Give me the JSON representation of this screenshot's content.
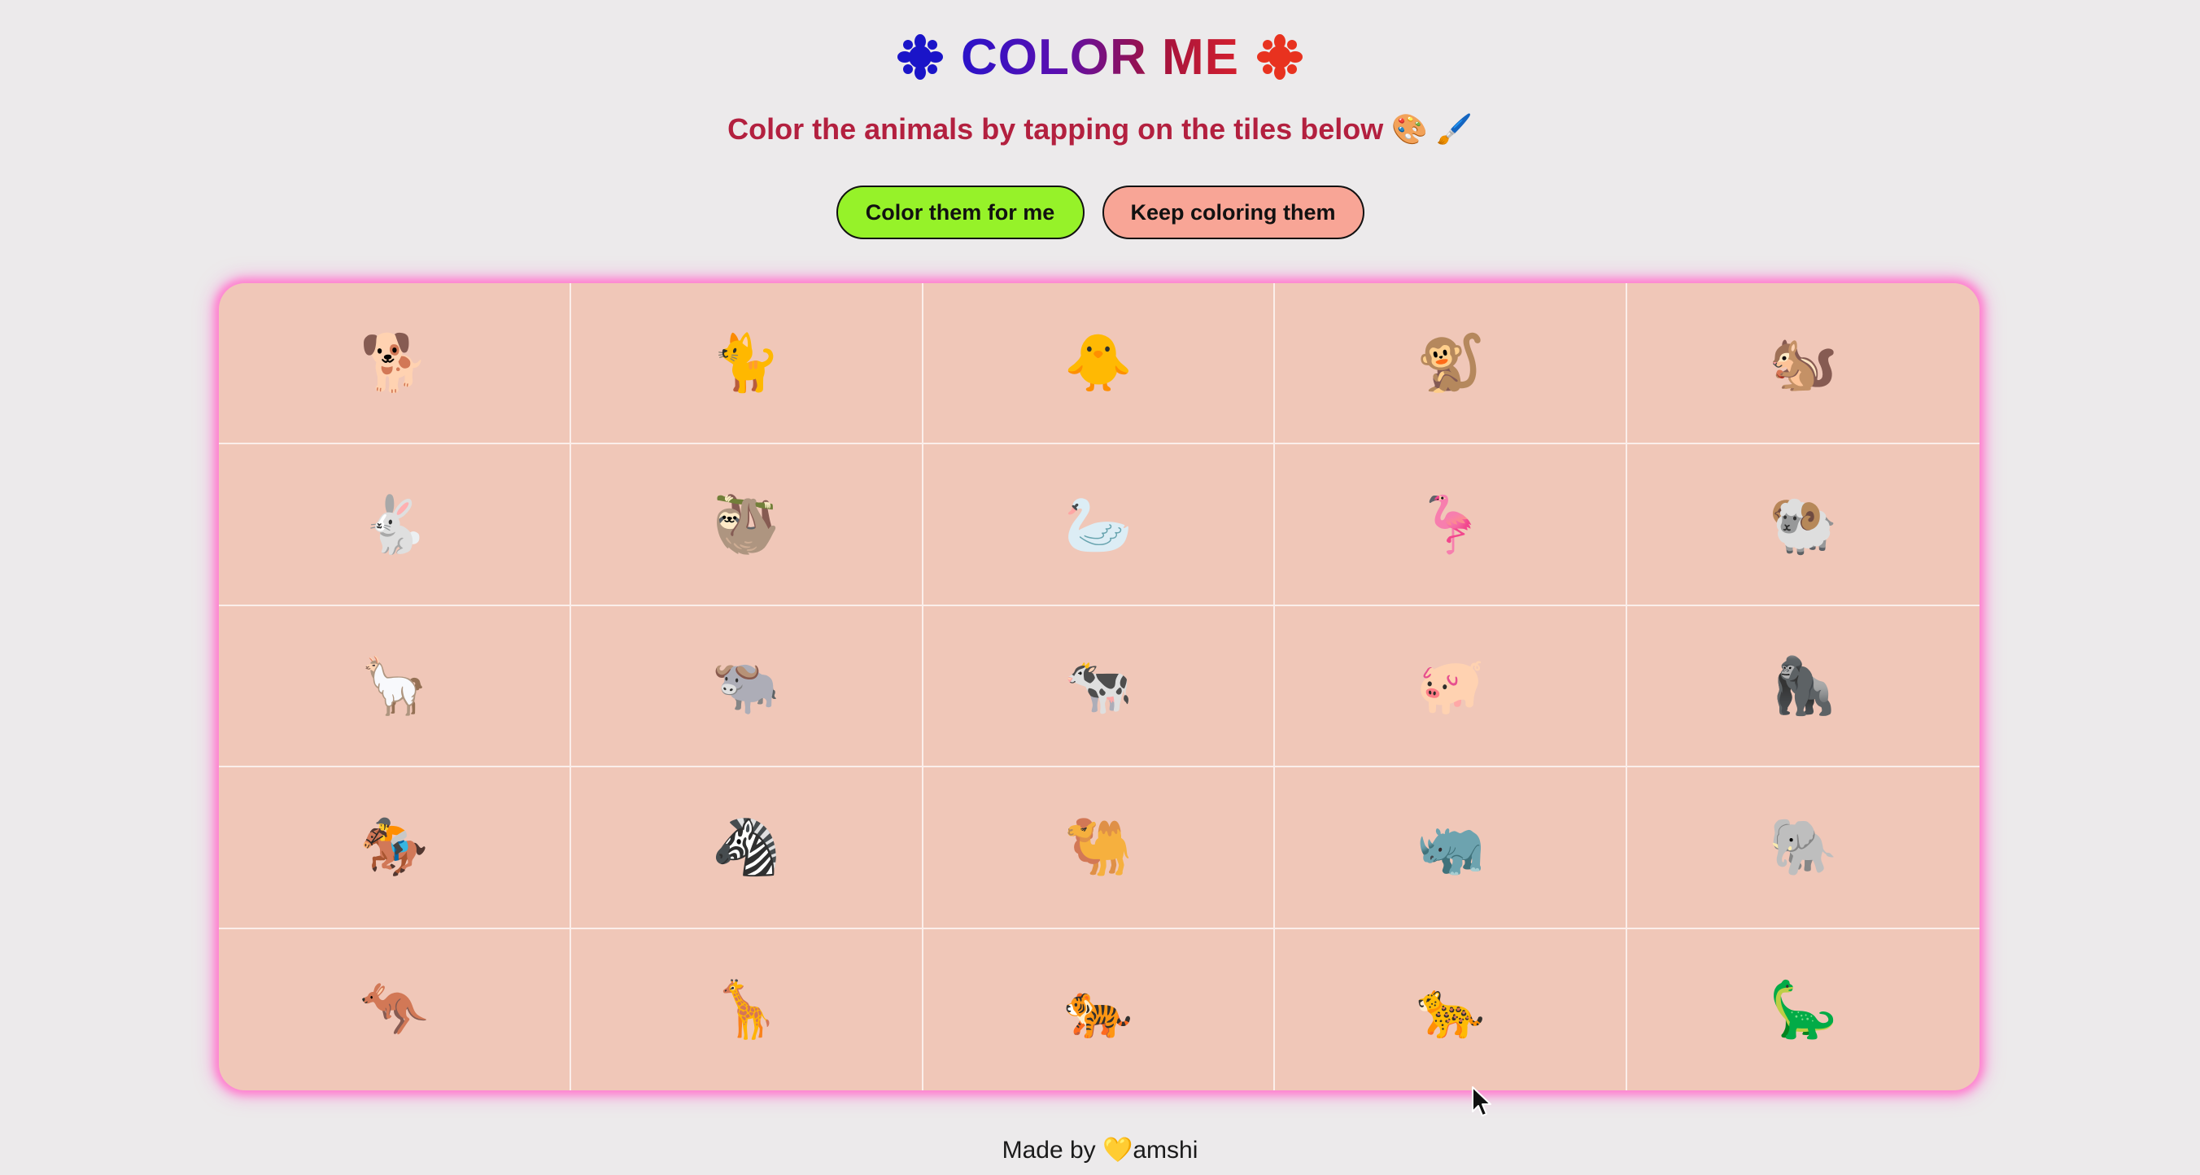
{
  "header": {
    "title": "COLOR ME",
    "left_icon": "paint-splat-blue-icon",
    "right_icon": "paint-splat-red-icon",
    "subtitle": "Color the animals by tapping on the tiles below 🎨 🖌️"
  },
  "buttons": {
    "color_for_me": "Color them for me",
    "keep_coloring": "Keep coloring them"
  },
  "colors": {
    "background": "#eceaeb",
    "tile_background": "#f0c7b8",
    "glow": "#ff7fcf",
    "subtitle": "#b3203f",
    "green_button": "#96f229",
    "pink_button": "#f8a596"
  },
  "tiles": [
    {
      "emoji": "🐕"
    },
    {
      "emoji": "🐈"
    },
    {
      "emoji": "🐥"
    },
    {
      "emoji": "🐒"
    },
    {
      "emoji": "🐿️"
    },
    {
      "emoji": "🐇"
    },
    {
      "emoji": "🦥"
    },
    {
      "emoji": "🦢"
    },
    {
      "emoji": "🦩"
    },
    {
      "emoji": "🐏"
    },
    {
      "emoji": "🦙"
    },
    {
      "emoji": "🐃"
    },
    {
      "emoji": "🐄"
    },
    {
      "emoji": "🐖"
    },
    {
      "emoji": "🦍"
    },
    {
      "emoji": "🏇"
    },
    {
      "emoji": "🦓"
    },
    {
      "emoji": "🐫"
    },
    {
      "emoji": "🦏"
    },
    {
      "emoji": "🐘"
    },
    {
      "emoji": "🦘"
    },
    {
      "emoji": "🦒"
    },
    {
      "emoji": "🐅"
    },
    {
      "emoji": "🐆"
    },
    {
      "emoji": "🦕"
    }
  ],
  "footer": {
    "prefix": "Made by ",
    "heart": "💛",
    "name": "amshi"
  }
}
